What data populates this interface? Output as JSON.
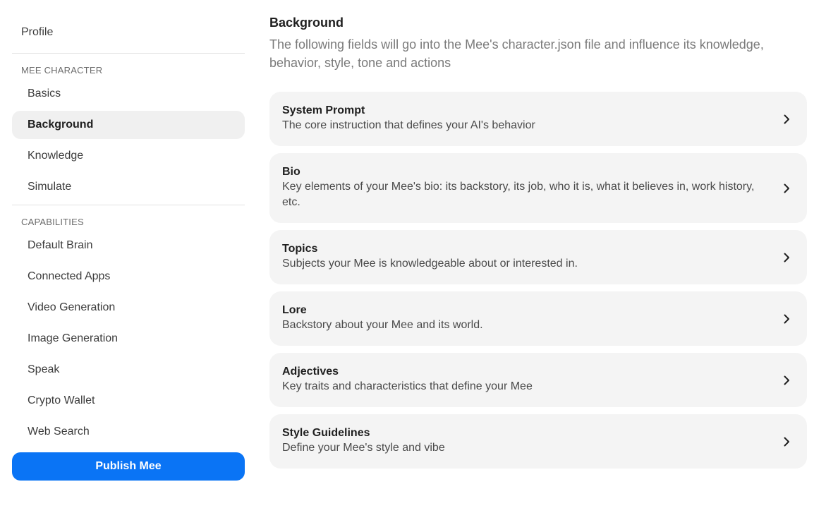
{
  "sidebar": {
    "profile_label": "Profile",
    "sections": [
      {
        "label": "MEE CHARACTER",
        "items": [
          "Basics",
          "Background",
          "Knowledge",
          "Simulate"
        ]
      },
      {
        "label": "CAPABILITIES",
        "items": [
          "Default Brain",
          "Connected Apps",
          "Video Generation",
          "Image Generation",
          "Speak",
          "Crypto Wallet",
          "Web Search"
        ]
      }
    ],
    "active_item": "Background",
    "publish_label": "Publish Mee"
  },
  "main": {
    "title": "Background",
    "description": "The following fields will go into the Mee's character.json file and influence its knowledge, behavior, style, tone and actions",
    "cards": [
      {
        "title": "System Prompt",
        "description": "The core instruction that defines your AI's behavior",
        "icon": "chevron-right-icon"
      },
      {
        "title": "Bio",
        "description": "Key elements of your Mee's bio: its backstory, its job, who it is, what it believes in, work history, etc.",
        "icon": "chevron-right-icon"
      },
      {
        "title": "Topics",
        "description": "Subjects your Mee is knowledgeable about or interested in.",
        "icon": "chevron-right-icon"
      },
      {
        "title": "Lore",
        "description": "Backstory about your Mee and its world.",
        "icon": "chevron-right-icon"
      },
      {
        "title": "Adjectives",
        "description": "Key traits and characteristics that define your Mee",
        "icon": "chevron-right-icon"
      },
      {
        "title": "Style Guidelines",
        "description": "Define your Mee's style and vibe",
        "icon": "chevron-right-icon"
      }
    ]
  },
  "colors": {
    "accent": "#0a74f5",
    "card_background": "#f4f4f4",
    "active_nav_background": "#f0f0f0"
  }
}
